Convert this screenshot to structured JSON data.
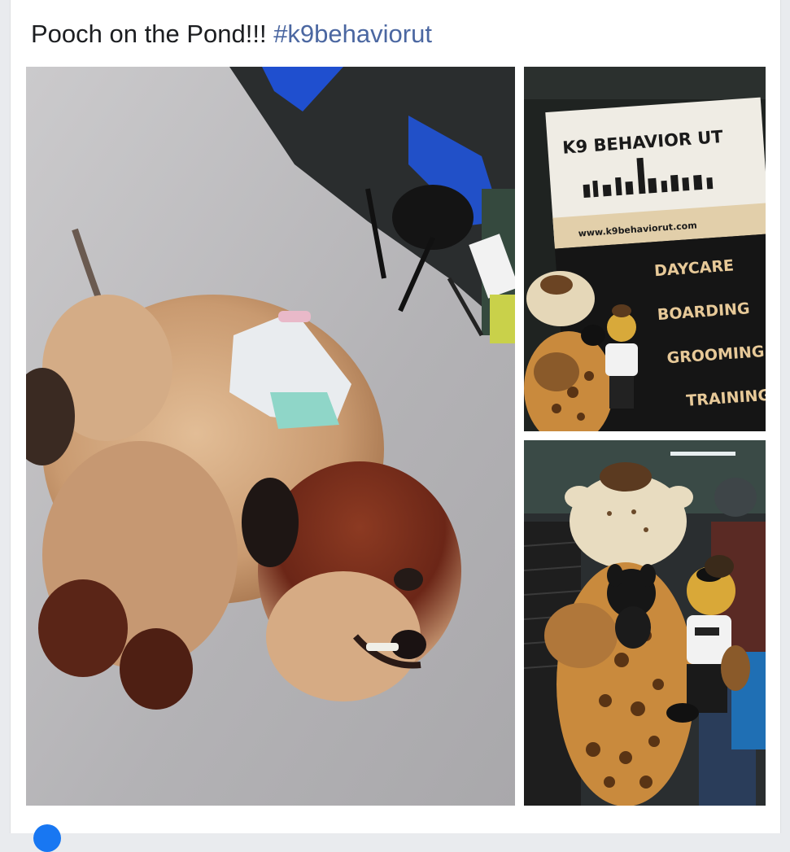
{
  "post": {
    "caption_text": "Pooch on the Pond!!!",
    "hashtag": "#k9behaviorut"
  },
  "photos": {
    "main": {
      "subject": "fluffy-dog-photo"
    },
    "banner": {
      "title": "K9 BEHAVIOR UT",
      "url": "www.k9behaviorut.com",
      "services": [
        "DAYCARE",
        "BOARDING",
        "GROOMING",
        "TRAINING"
      ]
    },
    "mascot": {
      "subject": "mascots-with-dog-photo"
    }
  },
  "colors": {
    "hashtag": "#4b67a1",
    "banner_top": "#efece4",
    "banner_mid": "#e2cfaa",
    "banner_bottom": "#151515"
  }
}
